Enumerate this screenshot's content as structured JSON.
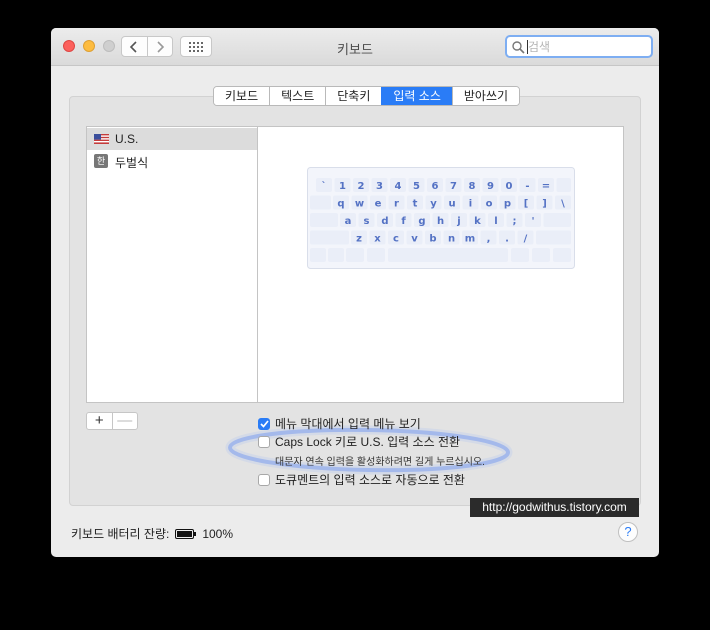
{
  "window": {
    "title": "키보드"
  },
  "search": {
    "placeholder": "검색"
  },
  "tabs": [
    {
      "label": "키보드"
    },
    {
      "label": "텍스트"
    },
    {
      "label": "단축키"
    },
    {
      "label": "입력 소스",
      "active": true
    },
    {
      "label": "받아쓰기"
    }
  ],
  "sources": [
    {
      "label": "U.S.",
      "icon": "us-flag-icon",
      "selected": true
    },
    {
      "label": "두벌식",
      "icon": "hangul-icon",
      "icon_text": "한"
    }
  ],
  "keyboard_rows": [
    [
      "`",
      "1",
      "2",
      "3",
      "4",
      "5",
      "6",
      "7",
      "8",
      "9",
      "0",
      "-",
      "="
    ],
    [
      "q",
      "w",
      "e",
      "r",
      "t",
      "y",
      "u",
      "i",
      "o",
      "p",
      "[",
      "]",
      "\\"
    ],
    [
      "a",
      "s",
      "d",
      "f",
      "g",
      "h",
      "j",
      "k",
      "l",
      ";",
      "'"
    ],
    [
      "z",
      "x",
      "c",
      "v",
      "b",
      "n",
      "m",
      ",",
      ".",
      "/"
    ]
  ],
  "list_controls": {
    "add": "+",
    "remove": "—"
  },
  "options": {
    "show_menu": {
      "label": "메뉴 막대에서 입력 메뉴 보기",
      "checked": true
    },
    "caps_lock": {
      "label": "Caps Lock 키로 U.S. 입력 소스 전환",
      "checked": false,
      "hint": "대문자 연속 입력을 활성화하려면 길게 누르십시오."
    },
    "auto_switch": {
      "label": "도큐멘트의 입력 소스로 자동으로 전환",
      "checked": false
    }
  },
  "watermark": "http://godwithus.tistory.com",
  "battery": {
    "label": "키보드 배터리 잔량:",
    "percent": "100%"
  },
  "help": "?",
  "colors": {
    "accent": "#2a7cf6",
    "halo": "#6f93ec"
  }
}
